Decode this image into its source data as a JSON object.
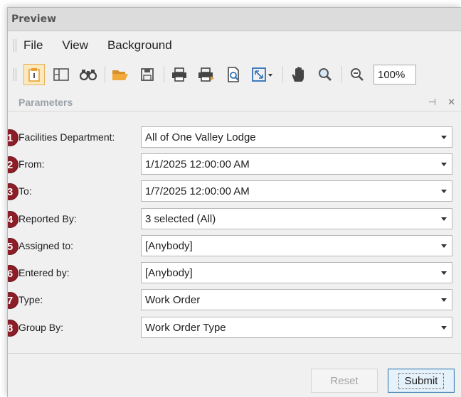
{
  "window": {
    "title": "Preview"
  },
  "menu": {
    "items": [
      "File",
      "View",
      "Background"
    ]
  },
  "toolbar": {
    "icons": [
      "parameters-icon",
      "document-map-icon",
      "search-icon",
      "open-icon",
      "save-icon",
      "print-icon",
      "quick-print-icon",
      "page-setup-icon",
      "scale-icon",
      "hand-tool-icon",
      "magnifier-icon",
      "zoom-out-icon"
    ],
    "zoom_value": "100%",
    "accent": "#e8a330"
  },
  "panel": {
    "title": "Parameters",
    "pin_glyph": "⊣",
    "close_glyph": "✕"
  },
  "parameters": [
    {
      "number": "1",
      "label": "Facilities Department:",
      "value": "All of One Valley Lodge"
    },
    {
      "number": "2",
      "label": "From:",
      "value": "1/1/2025 12:00:00 AM"
    },
    {
      "number": "3",
      "label": "To:",
      "value": "1/7/2025 12:00:00 AM"
    },
    {
      "number": "4",
      "label": "Reported By:",
      "value": "3 selected (All)"
    },
    {
      "number": "5",
      "label": "Assigned to:",
      "value": "[Anybody]"
    },
    {
      "number": "6",
      "label": "Entered by:",
      "value": "[Anybody]"
    },
    {
      "number": "7",
      "label": "Type:",
      "value": "Work Order"
    },
    {
      "number": "8",
      "label": "Group By:",
      "value": "Work Order Type"
    }
  ],
  "buttons": {
    "reset": "Reset",
    "submit": "Submit"
  },
  "colors": {
    "badge": "#8b1e27",
    "submit_border": "#3c7fb1"
  }
}
